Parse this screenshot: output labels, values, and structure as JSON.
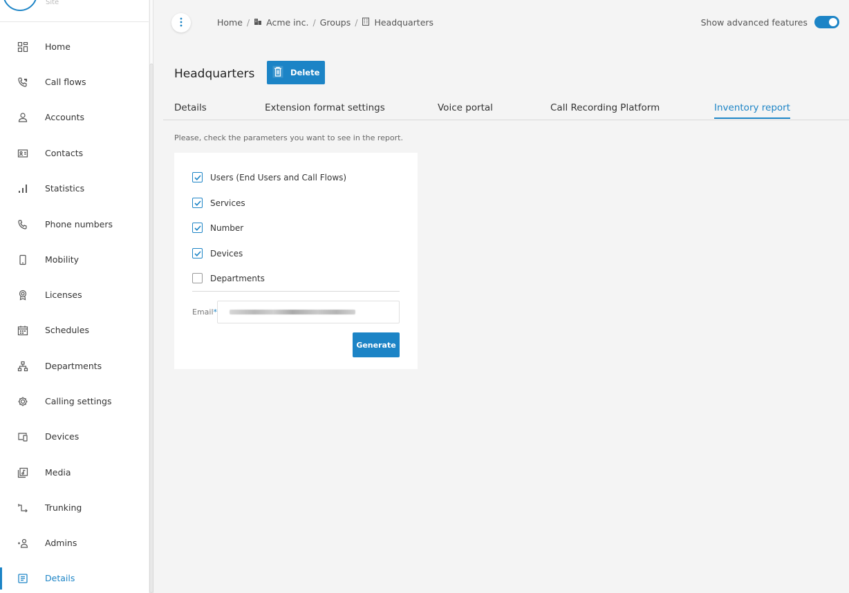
{
  "brand": {
    "subtitle": "Site"
  },
  "sidebar": {
    "items": [
      {
        "label": "Home",
        "icon": "dashboard-grid-icon"
      },
      {
        "label": "Call flows",
        "icon": "call-flow-icon"
      },
      {
        "label": "Accounts",
        "icon": "user-icon"
      },
      {
        "label": "Contacts",
        "icon": "contact-card-icon"
      },
      {
        "label": "Statistics",
        "icon": "bar-chart-icon"
      },
      {
        "label": "Phone numbers",
        "icon": "phone-icon"
      },
      {
        "label": "Mobility",
        "icon": "mobile-icon"
      },
      {
        "label": "Licenses",
        "icon": "license-badge-icon"
      },
      {
        "label": "Schedules",
        "icon": "calendar-icon"
      },
      {
        "label": "Departments",
        "icon": "org-chart-icon"
      },
      {
        "label": "Calling settings",
        "icon": "gear-icon"
      },
      {
        "label": "Devices",
        "icon": "devices-icon"
      },
      {
        "label": "Media",
        "icon": "media-icon"
      },
      {
        "label": "Trunking",
        "icon": "trunk-icon"
      },
      {
        "label": "Admins",
        "icon": "admin-icon"
      },
      {
        "label": "Details",
        "icon": "details-list-icon",
        "active": true
      }
    ]
  },
  "header": {
    "breadcrumb": [
      "Home",
      "Acme inc.",
      "Groups",
      "Headquarters"
    ],
    "advanced_label": "Show advanced features",
    "advanced_on": true
  },
  "page": {
    "title": "Headquarters",
    "delete_label": "Delete"
  },
  "tabs": [
    {
      "label": "Details"
    },
    {
      "label": "Extension format settings"
    },
    {
      "label": "Voice portal"
    },
    {
      "label": "Call Recording Platform"
    },
    {
      "label": "Inventory report",
      "active": true
    }
  ],
  "report": {
    "hint": "Please, check the parameters you want to see in the report.",
    "options": [
      {
        "label": "Users (End Users and Call Flows)",
        "checked": true
      },
      {
        "label": "Services",
        "checked": true
      },
      {
        "label": "Number",
        "checked": true
      },
      {
        "label": "Devices",
        "checked": true
      },
      {
        "label": "Departments",
        "checked": false
      }
    ],
    "email_label": "Email",
    "email_required_mark": "*",
    "generate_label": "Generate"
  },
  "colors": {
    "accent": "#1c84c6"
  }
}
